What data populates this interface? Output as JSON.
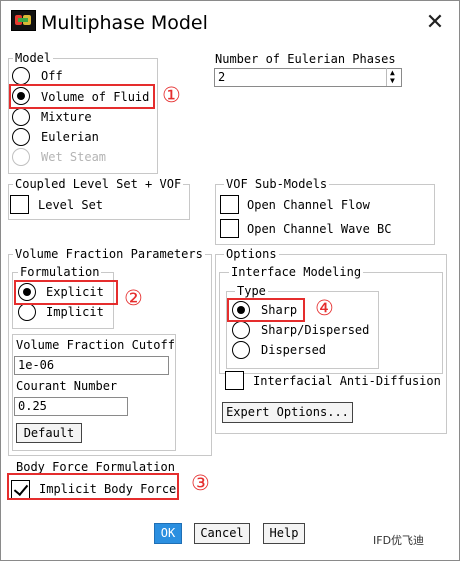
{
  "title": "Multiphase Model",
  "model": {
    "label": "Model",
    "options": [
      "Off",
      "Volume of Fluid",
      "Mixture",
      "Eulerian",
      "Wet Steam"
    ]
  },
  "eulerian_phases": {
    "label": "Number of Eulerian Phases",
    "value": "2"
  },
  "coupled": {
    "label": "Coupled Level Set + VOF",
    "level_set": "Level Set"
  },
  "vof_sub": {
    "label": "VOF Sub-Models",
    "open_channel": "Open Channel Flow",
    "wave_bc": "Open Channel Wave BC"
  },
  "vfp": {
    "label": "Volume Fraction Parameters",
    "formulation_label": "Formulation",
    "explicit": "Explicit",
    "implicit": "Implicit",
    "cutoff_label": "Volume Fraction Cutoff",
    "cutoff_value": "1e-06",
    "courant_label": "Courant Number",
    "courant_value": "0.25",
    "default_btn": "Default"
  },
  "options": {
    "label": "Options",
    "interface_label": "Interface Modeling",
    "type_label": "Type",
    "sharp": "Sharp",
    "sharp_dispersed": "Sharp/Dispersed",
    "dispersed": "Dispersed",
    "anti_diffusion": "Interfacial Anti-Diffusion",
    "expert_btn": "Expert Options..."
  },
  "body_force": {
    "label": "Body Force Formulation",
    "implicit": "Implicit Body Force"
  },
  "buttons": {
    "ok": "OK",
    "cancel": "Cancel",
    "help": "Help"
  },
  "annotations": [
    "①",
    "②",
    "③",
    "④"
  ],
  "watermark": "IFD优飞迪"
}
